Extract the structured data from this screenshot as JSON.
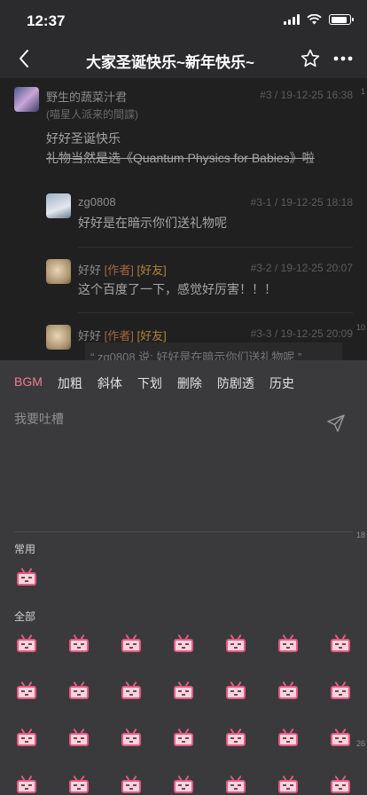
{
  "status": {
    "time": "12:37"
  },
  "nav": {
    "title": "大家圣诞快乐~新年快乐~"
  },
  "posts": [
    {
      "name": "野生的蔬菜汁君",
      "sub": "(喵星人派来的間諜)",
      "meta": "#3 / 19-12-25 16:38",
      "lines": [
        "好好圣诞快乐",
        "礼物当然是选《Quantum Physics for Babies》啦"
      ]
    },
    {
      "name": "zg0808",
      "meta": "#3-1 / 19-12-25 18:18",
      "body": "好好是在暗示你们送礼物呢"
    },
    {
      "name": "好好",
      "tag_author": "[作者]",
      "tag_friend": "[好友]",
      "meta": "#3-2 / 19-12-25 20:07",
      "body": "这个百度了一下，感觉好厉害！！！"
    },
    {
      "name": "好好",
      "tag_author": "[作者]",
      "tag_friend": "[好友]",
      "meta": "#3-3 / 19-12-25 20:09",
      "quote": "“ zg0808 说: 好好是在暗示你们送礼物呢 ”"
    }
  ],
  "page_markers": [
    "1",
    "10",
    "18",
    "26"
  ],
  "editor": {
    "toolbar": [
      "BGM",
      "加粗",
      "斜体",
      "下划",
      "删除",
      "防剧透",
      "历史"
    ],
    "placeholder": "我要吐槽",
    "section_common": "常用",
    "section_all": "全部"
  },
  "colors": {
    "accent": "#f07b8f",
    "emoji_pink": "#e45b82"
  },
  "icons": [
    "back-chevron-icon",
    "star-icon",
    "more-icon",
    "send-icon",
    "bgm-tv-emoji-icon"
  ]
}
